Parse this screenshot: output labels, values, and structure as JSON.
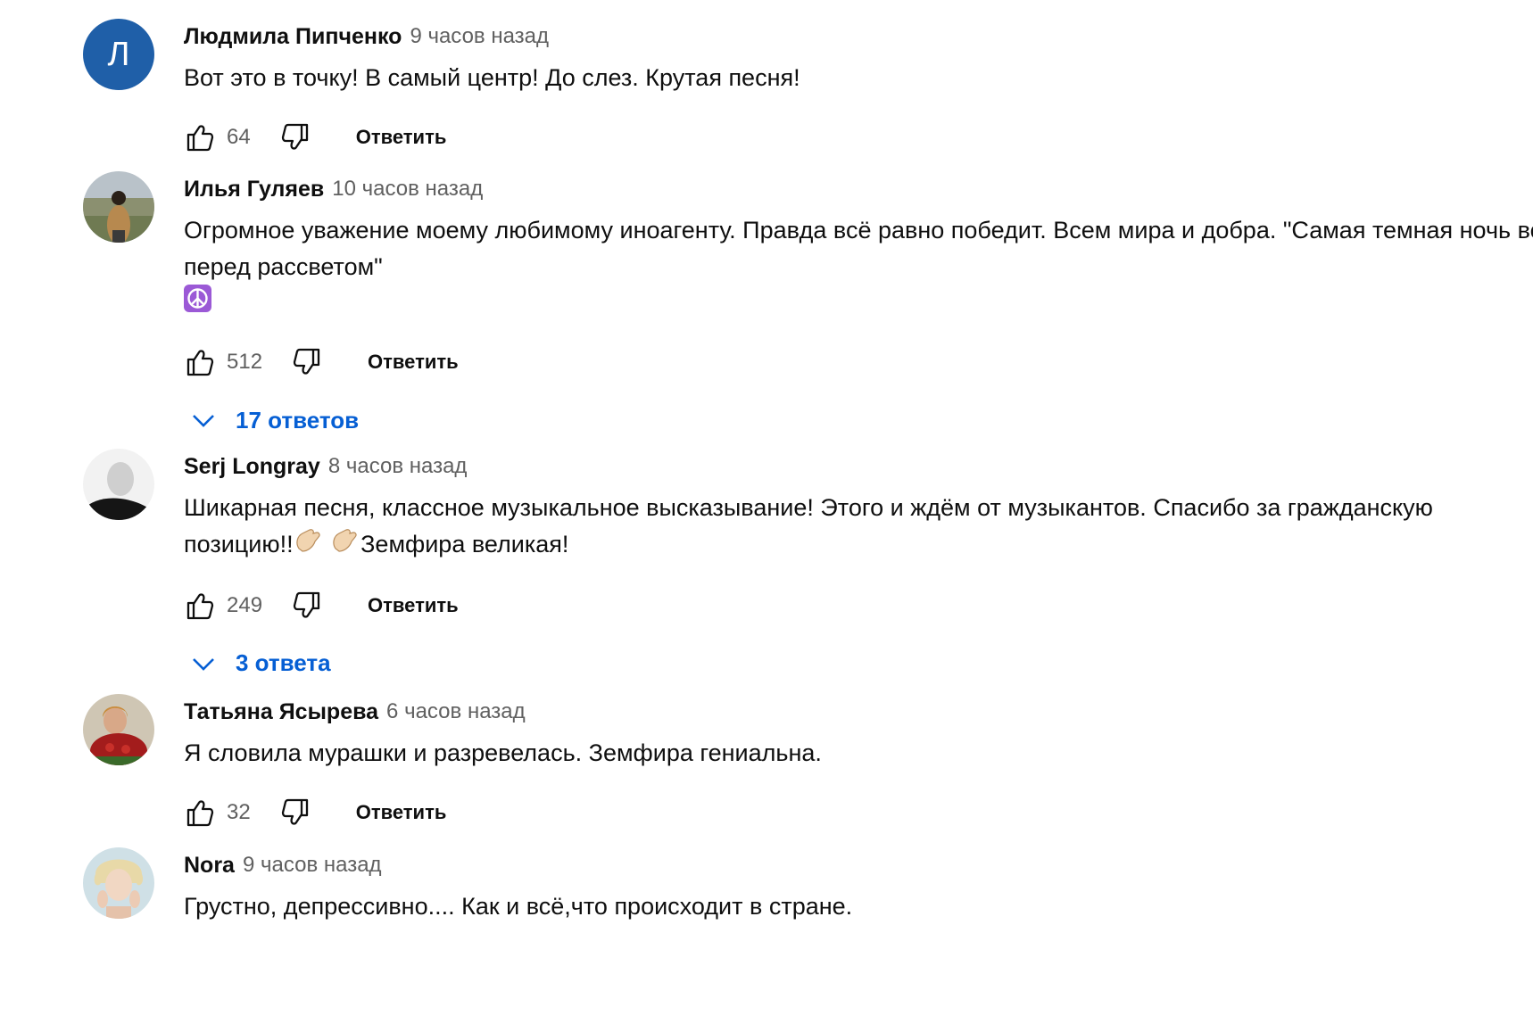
{
  "ui": {
    "reply_label": "Ответить"
  },
  "comments": [
    {
      "author": "Людмила Пипченко",
      "time": "9 часов назад",
      "avatar_letter": "Л",
      "text": "Вот это в точку! В самый центр! До слез. Крутая песня!",
      "likes": "64"
    },
    {
      "author": "Илья Гуляев",
      "time": "10 часов назад",
      "text": "Огромное уважение моему любимому иноагенту. Правда всё равно победит. Всем мира и добра. \"Самая темная ночь всегда перед рассветом\"",
      "emoji_line": "peace-symbol-emoji",
      "likes": "512",
      "replies": "17 ответов"
    },
    {
      "author": "Serj Longray",
      "time": "8 часов назад",
      "text_line1": "Шикарная песня, классное музыкальное высказывание! Этого и ждём от музыкантов. Спасибо за гражданскую",
      "text_line2_prefix": "позицию!!",
      "text_line2_suffix": "Земфира великая!",
      "emojis": [
        "clapping-hands-emoji",
        "clapping-hands-emoji"
      ],
      "likes": "249",
      "replies": "3 ответа"
    },
    {
      "author": "Татьяна Ясырева",
      "time": "6 часов назад",
      "text": "Я словила мурашки и разревелась. Земфира гениальна.",
      "likes": "32"
    },
    {
      "author": "Nora",
      "time": "9 часов назад",
      "text": "Грустно, депрессивно.... Как и всё,что происходит в стране."
    }
  ],
  "colors": {
    "link_blue": "#065fd4",
    "secondary_text": "#606060",
    "primary_text": "#0f0f0f",
    "avatar_blue": "#1f5fa8"
  }
}
